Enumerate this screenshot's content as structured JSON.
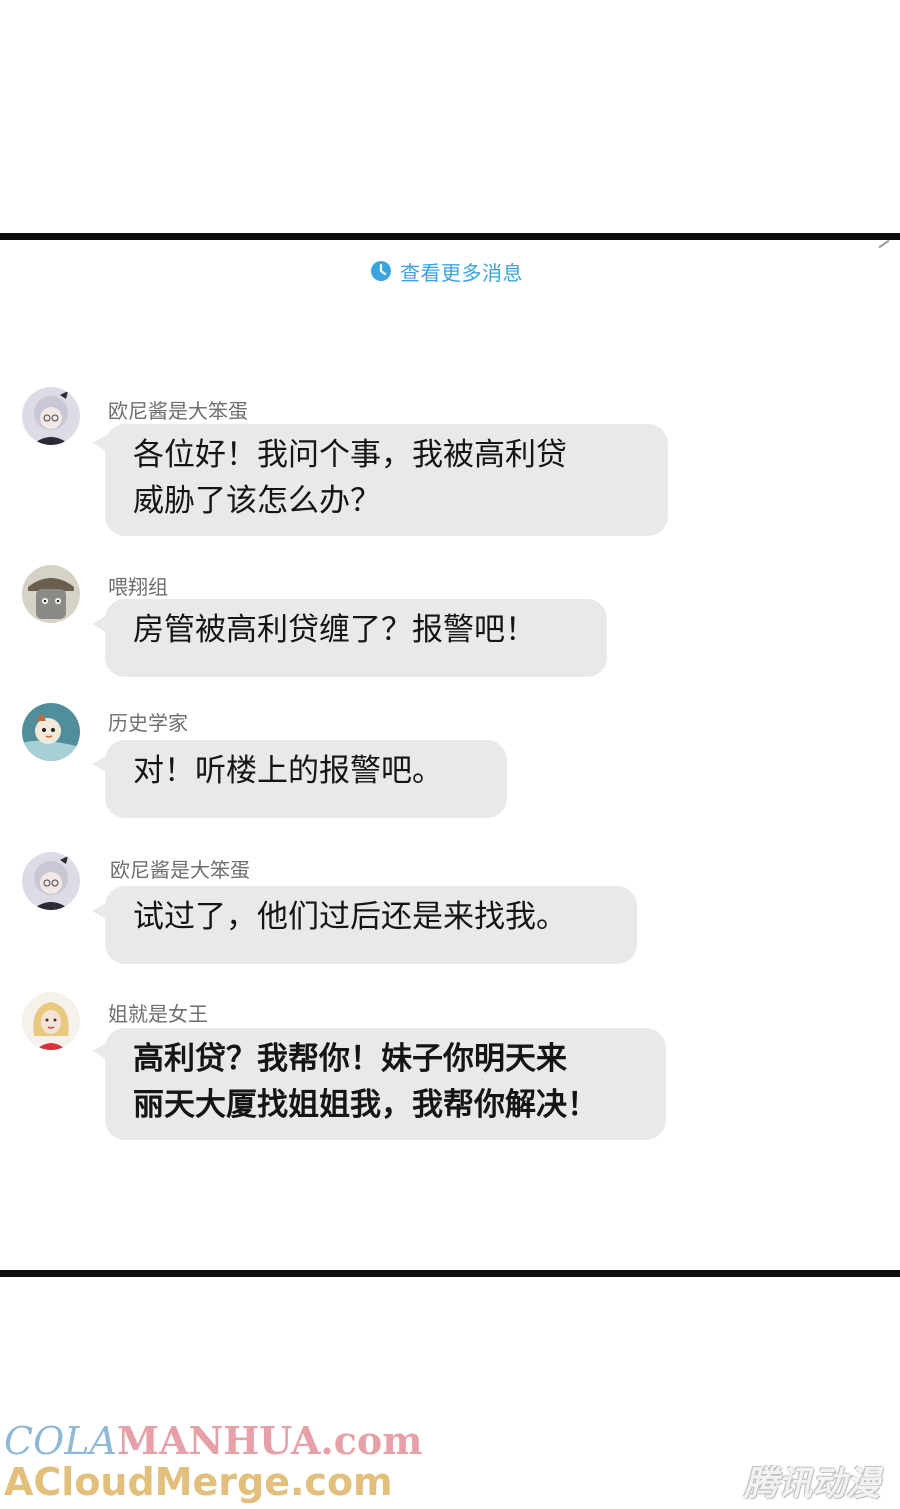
{
  "header": {
    "more_messages": "查看更多消息",
    "more_icon": "clock-icon"
  },
  "messages": [
    {
      "sender": "欧尼酱是大笨蛋",
      "avatar": "avatar-silver-hair-girl",
      "lines": [
        "各位好！我问个事，我被高利贷",
        "威胁了该怎么办？"
      ]
    },
    {
      "sender": "喂翔组",
      "avatar": "avatar-cartoon-figure",
      "lines": [
        "房管被高利贷缠了？报警吧！"
      ]
    },
    {
      "sender": "历史学家",
      "avatar": "avatar-cartoon-animal",
      "lines": [
        "对！听楼上的报警吧。"
      ]
    },
    {
      "sender": "欧尼酱是大笨蛋",
      "avatar": "avatar-silver-hair-girl",
      "lines": [
        "试过了，他们过后还是来找我。"
      ]
    },
    {
      "sender": "姐就是女王",
      "avatar": "avatar-blonde-woman",
      "lines": [
        "高利贷？我帮你！妹子你明天来",
        "丽天大厦找姐姐我，我帮你解决！"
      ]
    }
  ],
  "watermark": {
    "line1_a": "COLA",
    "line1_b": "MANHUA.com",
    "line2": "ACloudMerge.com",
    "brand": "腾讯动漫"
  }
}
